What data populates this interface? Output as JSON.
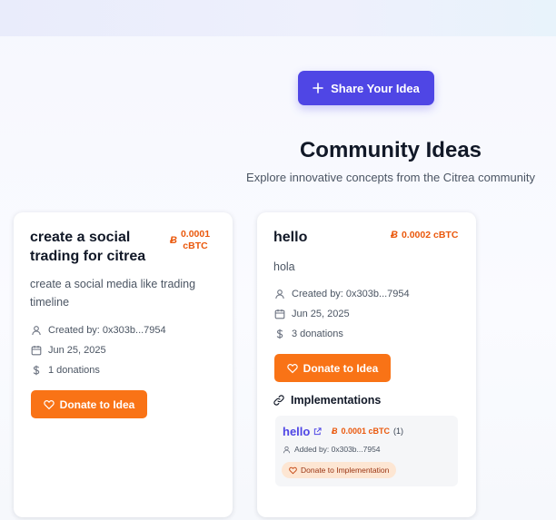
{
  "header": {
    "share_label": "Share Your Idea"
  },
  "section": {
    "title": "Community Ideas",
    "subtitle": "Explore innovative concepts from the Citrea community"
  },
  "ideas": [
    {
      "title": "create a social trading for citrea",
      "amount_line1": "0.0001",
      "amount_line2": "cBTC",
      "description": "create a social media like trading timeline",
      "created_by": "Created by: 0x303b...7954",
      "date": "Jun 25, 2025",
      "donations": "1 donations",
      "donate_label": "Donate to Idea"
    },
    {
      "title": "hello",
      "amount": "0.0002 cBTC",
      "description": "hola",
      "created_by": "Created by: 0x303b...7954",
      "date": "Jun 25, 2025",
      "donations": "3 donations",
      "donate_label": "Donate to Idea",
      "implementations_heading": "Implementations",
      "implementations": [
        {
          "name": "hello",
          "amount": "0.0001 cBTC",
          "count": "(1)",
          "added_by": "Added by: 0x303b...7954",
          "donate_label": "Donate to Implementation"
        }
      ]
    }
  ],
  "icons": {
    "currency_glyph": "Ƀ"
  },
  "colors": {
    "primary": "#4f46e5",
    "accent": "#f97316",
    "amount": "#ea580c",
    "title": "#111827",
    "muted": "#4b5563"
  }
}
